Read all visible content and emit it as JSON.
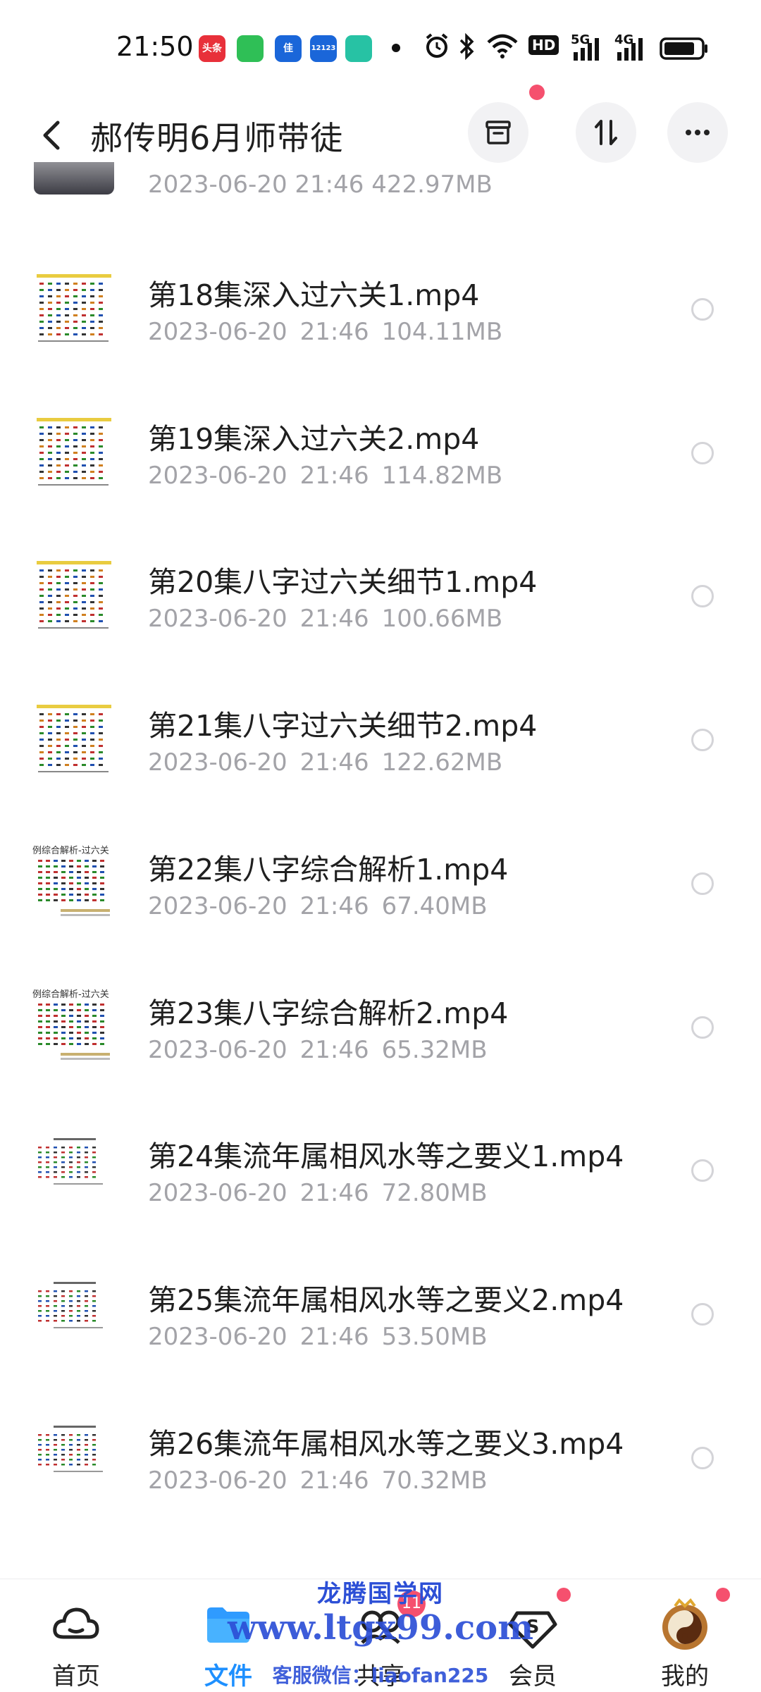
{
  "status_bar": {
    "time": "21:50",
    "app_icons": [
      {
        "name": "toutiao-icon",
        "label": "头条",
        "color": "#e8303a"
      },
      {
        "name": "messages-icon",
        "label": "",
        "color": "#2fbf56"
      },
      {
        "name": "app-jia-icon",
        "label": "佳",
        "color": "#1a66d9"
      },
      {
        "name": "app-12123-icon",
        "label": "12123",
        "color": "#1a66d9"
      },
      {
        "name": "app-green-icon",
        "label": "",
        "color": "#27c2a4"
      }
    ],
    "hd_label": "HD",
    "net_5g": "5G",
    "net_4g": "4G"
  },
  "header": {
    "title": "郝传明6月师带徒"
  },
  "partial_row": {
    "meta": "2023-06-20  21:46  422.97MB"
  },
  "files": [
    {
      "name": "第18集深入过六关1.mp4",
      "date": "2023-06-20",
      "time": "21:46",
      "size": "104.11MB",
      "thumb": "table"
    },
    {
      "name": "第19集深入过六关2.mp4",
      "date": "2023-06-20",
      "time": "21:46",
      "size": "114.82MB",
      "thumb": "table"
    },
    {
      "name": "第20集八字过六关细节1.mp4",
      "date": "2023-06-20",
      "time": "21:46",
      "size": "100.66MB",
      "thumb": "table"
    },
    {
      "name": "第21集八字过六关细节2.mp4",
      "date": "2023-06-20",
      "time": "21:46",
      "size": "122.62MB",
      "thumb": "table"
    },
    {
      "name": "第22集八字综合解析1.mp4",
      "date": "2023-06-20",
      "time": "21:46",
      "size": "67.40MB",
      "thumb": "analysis",
      "thumb_title": "例综合解析-过六关"
    },
    {
      "name": "第23集八字综合解析2.mp4",
      "date": "2023-06-20",
      "time": "21:46",
      "size": "65.32MB",
      "thumb": "analysis",
      "thumb_title": "例综合解析-过六关"
    },
    {
      "name": "第24集流年属相风水等之要义1.mp4",
      "date": "2023-06-20",
      "time": "21:46",
      "size": "72.80MB",
      "thumb": "small"
    },
    {
      "name": "第25集流年属相风水等之要义2.mp4",
      "date": "2023-06-20",
      "time": "21:46",
      "size": "53.50MB",
      "thumb": "small"
    },
    {
      "name": "第26集流年属相风水等之要义3.mp4",
      "date": "2023-06-20",
      "time": "21:46",
      "size": "70.32MB",
      "thumb": "small"
    }
  ],
  "bottom_nav": [
    {
      "key": "home",
      "label": "首页",
      "active": false
    },
    {
      "key": "files",
      "label": "文件",
      "active": true
    },
    {
      "key": "share",
      "label": "共享",
      "active": false,
      "badge": "11"
    },
    {
      "key": "vip",
      "label": "会员",
      "active": false,
      "dot": true
    },
    {
      "key": "me",
      "label": "我的",
      "active": false,
      "dot": true
    }
  ],
  "watermark": {
    "line1": "龙腾国学网",
    "line2": "www.ltgx99.com",
    "line3": "客服微信：liaofan225"
  },
  "colors": {
    "accent": "#1e90ff",
    "badge": "#f5506e",
    "meta_gray": "#a3a3a8",
    "watermark": "#2c4fd6"
  }
}
